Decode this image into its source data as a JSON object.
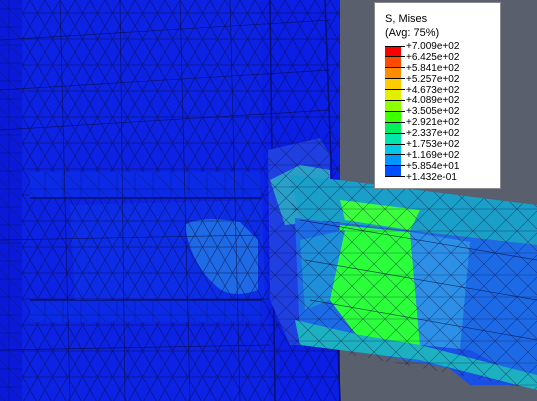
{
  "legend": {
    "title": "S, Mises",
    "subtitle": "(Avg: 75%)",
    "levels": [
      {
        "value": "+7.009e+02",
        "color": "#ff0000"
      },
      {
        "value": "+6.425e+02",
        "color": "#ff4a00"
      },
      {
        "value": "+5.841e+02",
        "color": "#ff8c00"
      },
      {
        "value": "+5.257e+02",
        "color": "#ffcc00"
      },
      {
        "value": "+4.673e+02",
        "color": "#e0f000"
      },
      {
        "value": "+4.089e+02",
        "color": "#8cff00"
      },
      {
        "value": "+3.505e+02",
        "color": "#3cff00"
      },
      {
        "value": "+2.921e+02",
        "color": "#00f05a"
      },
      {
        "value": "+2.337e+02",
        "color": "#00e6aa"
      },
      {
        "value": "+1.753e+02",
        "color": "#00c8e6"
      },
      {
        "value": "+1.169e+02",
        "color": "#0096ff"
      },
      {
        "value": "+5.854e+01",
        "color": "#0050ff"
      }
    ],
    "min_value": "+1.432e-01",
    "min_color": "#0010d8"
  },
  "model": {
    "background_color": "#5a5f6e",
    "low_stress_color": "#0a1ee6",
    "mid_stress_color": "#1e64e6",
    "high_stress_color": "#3cff3c",
    "mesh_line_color": "#0b0b3a"
  }
}
